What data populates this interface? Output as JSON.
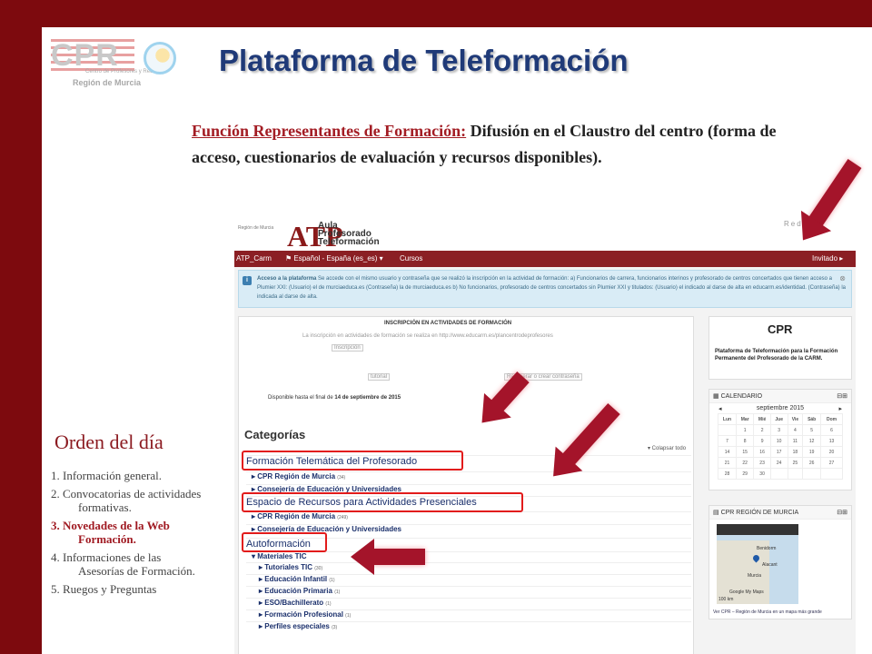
{
  "slide": {
    "logo": {
      "letters": "CPR",
      "line1": "Centro de Profesores y Recursos",
      "line2": "Región de Murcia"
    },
    "title": "Plataforma de Teleformación",
    "intro_label": "Función Representantes de Formación:",
    "intro_text": " Difusión en  el Claustro del centro (forma de acceso, cuestionarios de evaluación y recursos disponibles)."
  },
  "agenda": {
    "title": "Orden del día",
    "items": [
      "1.  Información general.",
      "2.  Convocatorias de actividades formativas.",
      "3.  Novedades de la  Web Formación.",
      "4.  Informaciones de las Asesorías de Formación.",
      "5.  Ruegos y Preguntas"
    ]
  },
  "site": {
    "murcia": "Región de Murcia",
    "logo_letters": "ATP",
    "logo_words": "Aula\nProfesorado\nTeleformación",
    "redes": "Redes s",
    "nav": {
      "site": "ATP_Carm",
      "lang": "⚑ Español - España (es_es) ▾",
      "cursos": "Cursos",
      "user": "Invitado ▸"
    },
    "notice_bold": "Acceso a la plataforma",
    "notice": " Se accede con el mismo usuario y contraseña que se realizó la inscripción en la actividad de formación: a) Funcionarios de carrera, funcionarios interinos y profesorado de centros concertados que tienen acceso a Plumier XXI: (Usuario) el de murciaeduca.es (Contraseña) la de murciaeduca.es b) No funcionarios, profesorado de centros concertados sin Plumier XXI y titulados: (Usuario) el indicado al darse de alta en educarm.es/identidad. (Contraseña) la indicada al darse de alta.",
    "ins_title": "INSCRIPCIÓN EN ACTIVIDADES DE FORMACIÓN",
    "ins_sub": "La inscripción en actividades de formación se realiza en http://www.educarm.es/plancentrodeprofesores",
    "img_inscripcion": "Inscripción",
    "img_tutorial": "tutorial",
    "img_recuperar": "Recuperar o crear contraseña",
    "avail_prefix": "Disponible hasta el final de ",
    "avail_date": "14 de septiembre de 2015",
    "cat_head": "Categorías",
    "collapse": "▾ Colapsar todo",
    "categories": [
      {
        "label": "Formación Telemática del Profesorado",
        "count": ""
      },
      {
        "label": "CPR Región de Murcia",
        "count": "(34)"
      },
      {
        "label": "Consejería de Educación y Universidades",
        "count": ""
      },
      {
        "label": "Espacio de Recursos para Actividades Presenciales",
        "count": ""
      },
      {
        "label": "CPR Región de Murcia",
        "count": "(249)"
      },
      {
        "label": "Consejería de Educación y Universidades",
        "count": ""
      },
      {
        "label": "Autoformación",
        "count": ""
      },
      {
        "label": "Materiales TIC",
        "count": ""
      },
      {
        "label": "Tutoriales TIC",
        "count": "(30)"
      },
      {
        "label": "Educación Infantil",
        "count": "(1)"
      },
      {
        "label": "Educación Primaria",
        "count": "(1)"
      },
      {
        "label": "ESO/Bachillerato",
        "count": "(1)"
      },
      {
        "label": "Formación Profesional",
        "count": "(1)"
      },
      {
        "label": "Perfiles especiales",
        "count": "(3)"
      }
    ],
    "side1": {
      "logo": "CPR",
      "text": "Plataforma de Teleformación para la Formación Permanente del Profesorado de la CARM."
    },
    "calendar": {
      "title": "CALENDARIO",
      "month": "septiembre 2015",
      "days": [
        "Lun",
        "Mar",
        "Mié",
        "Jue",
        "Vie",
        "Sáb",
        "Dom"
      ],
      "weeks": [
        [
          "",
          "1",
          "2",
          "3",
          "4",
          "5",
          "6"
        ],
        [
          "7",
          "8",
          "9",
          "10",
          "11",
          "12",
          "13"
        ],
        [
          "14",
          "15",
          "16",
          "17",
          "18",
          "19",
          "20"
        ],
        [
          "21",
          "22",
          "23",
          "24",
          "25",
          "26",
          "27"
        ],
        [
          "28",
          "29",
          "30",
          "",
          "",
          "",
          ""
        ]
      ]
    },
    "map": {
      "title": "CPR REGIÓN DE MURCIA",
      "places": [
        "Benidorm",
        "Alacant",
        "Murcia"
      ],
      "attribution": "Google My Maps",
      "scale": "100 km",
      "footer": "Ver CPR – Región de Murcia en un mapa más grande"
    }
  },
  "colors": {
    "frame": "#7d0a0e",
    "title": "#1f3a78",
    "accent": "#a31d24",
    "highlight": "#e21b1b",
    "arrow": "#a4142a"
  }
}
